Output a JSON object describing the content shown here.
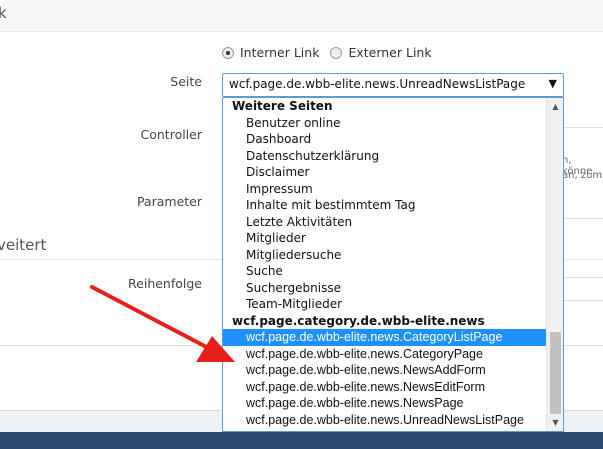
{
  "sections": {
    "general_title": "k",
    "advanced_title": "veitert"
  },
  "form": {
    "link_type": {
      "internal_label": "Interner Link",
      "external_label": "Externer Link",
      "selected": "Interner Link"
    },
    "seite_label": "Seite",
    "seite_value": "wcf.page.de.wbb-elite.news.UnreadNewsListPage",
    "controller_label": "Controller",
    "parameter_label": "Parameter",
    "reihenfolge_label": "Reihenfolge",
    "ghost_text_1": "n, könne",
    "ghost_text_2": "an, zum"
  },
  "dropdown": {
    "groups": [
      {
        "label": "Weitere Seiten",
        "options": [
          "Benutzer online",
          "Dashboard",
          "Datenschutzerklärung",
          "Disclaimer",
          "Impressum",
          "Inhalte mit bestimmtem Tag",
          "Letzte Aktivitäten",
          "Mitglieder",
          "Mitgliedersuche",
          "Suche",
          "Suchergebnisse",
          "Team-Mitglieder"
        ]
      },
      {
        "label": "wcf.page.category.de.wbb-elite.news",
        "options": [
          "wcf.page.de.wbb-elite.news.CategoryListPage",
          "wcf.page.de.wbb-elite.news.CategoryPage",
          "wcf.page.de.wbb-elite.news.NewsAddForm",
          "wcf.page.de.wbb-elite.news.NewsEditForm",
          "wcf.page.de.wbb-elite.news.NewsPage",
          "wcf.page.de.wbb-elite.news.UnreadNewsListPage"
        ]
      }
    ],
    "highlighted": "wcf.page.de.wbb-elite.news.CategoryListPage"
  },
  "icons": {
    "select_arrow": "▼",
    "scroll_up": "▲",
    "scroll_down": "▼"
  },
  "colors": {
    "accent": "#1e90ff",
    "annotation_arrow": "#e8201b",
    "footer": "#2c4a6b"
  }
}
